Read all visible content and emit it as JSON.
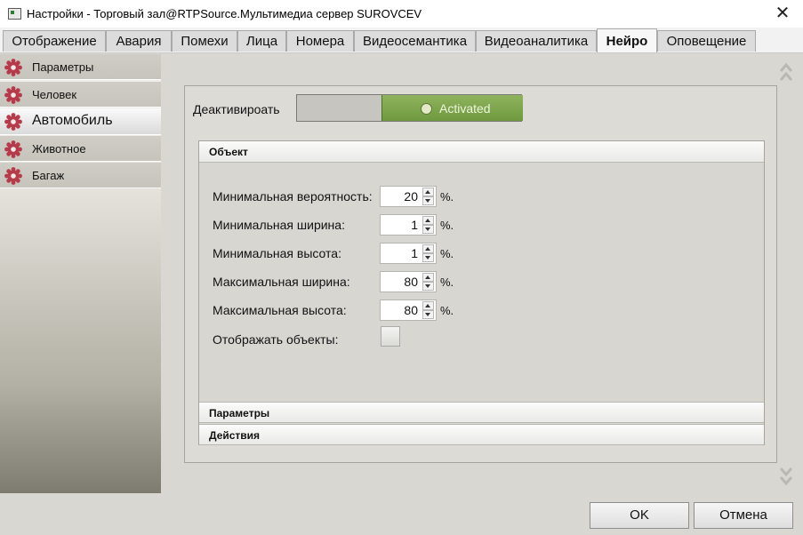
{
  "window": {
    "title": "Настройки - Торговый зал@RTPSource.Мультимедиа сервер SUROVCEV",
    "close_glyph": "✕"
  },
  "tabs": [
    {
      "label": "Отображение"
    },
    {
      "label": "Авария"
    },
    {
      "label": "Помехи"
    },
    {
      "label": "Лица"
    },
    {
      "label": "Номера"
    },
    {
      "label": "Видеосемантика"
    },
    {
      "label": "Видеоаналитика"
    },
    {
      "label": "Нейро",
      "active": true
    },
    {
      "label": "Оповещение"
    }
  ],
  "sidebar": {
    "icon": "gear-icon",
    "icon_color": "#b53a4a",
    "items": [
      {
        "label": "Параметры"
      },
      {
        "label": "Человек"
      },
      {
        "label": "Автомобиль",
        "active": true
      },
      {
        "label": "Животное"
      },
      {
        "label": "Багаж"
      }
    ]
  },
  "panel": {
    "deactivate_label": "Деактивироать",
    "toggle": {
      "state_text": "Activated",
      "on_color": "#7ea64d"
    },
    "object_group": {
      "header": "Объект",
      "fields": [
        {
          "label": "Минимальная вероятность:",
          "value": "20",
          "unit": "%."
        },
        {
          "label": "Минимальная ширина:",
          "value": "1",
          "unit": "%."
        },
        {
          "label": "Минимальная высота:",
          "value": "1",
          "unit": "%."
        },
        {
          "label": "Максимальная ширина:",
          "value": "80",
          "unit": "%."
        },
        {
          "label": "Максимальная высота:",
          "value": "80",
          "unit": "%."
        }
      ],
      "show_objects_label": "Отображать объекты:",
      "show_objects_checked": false
    },
    "params_header": "Параметры",
    "actions_header": "Действия"
  },
  "buttons": {
    "ok": "OK",
    "cancel": "Отмена"
  }
}
